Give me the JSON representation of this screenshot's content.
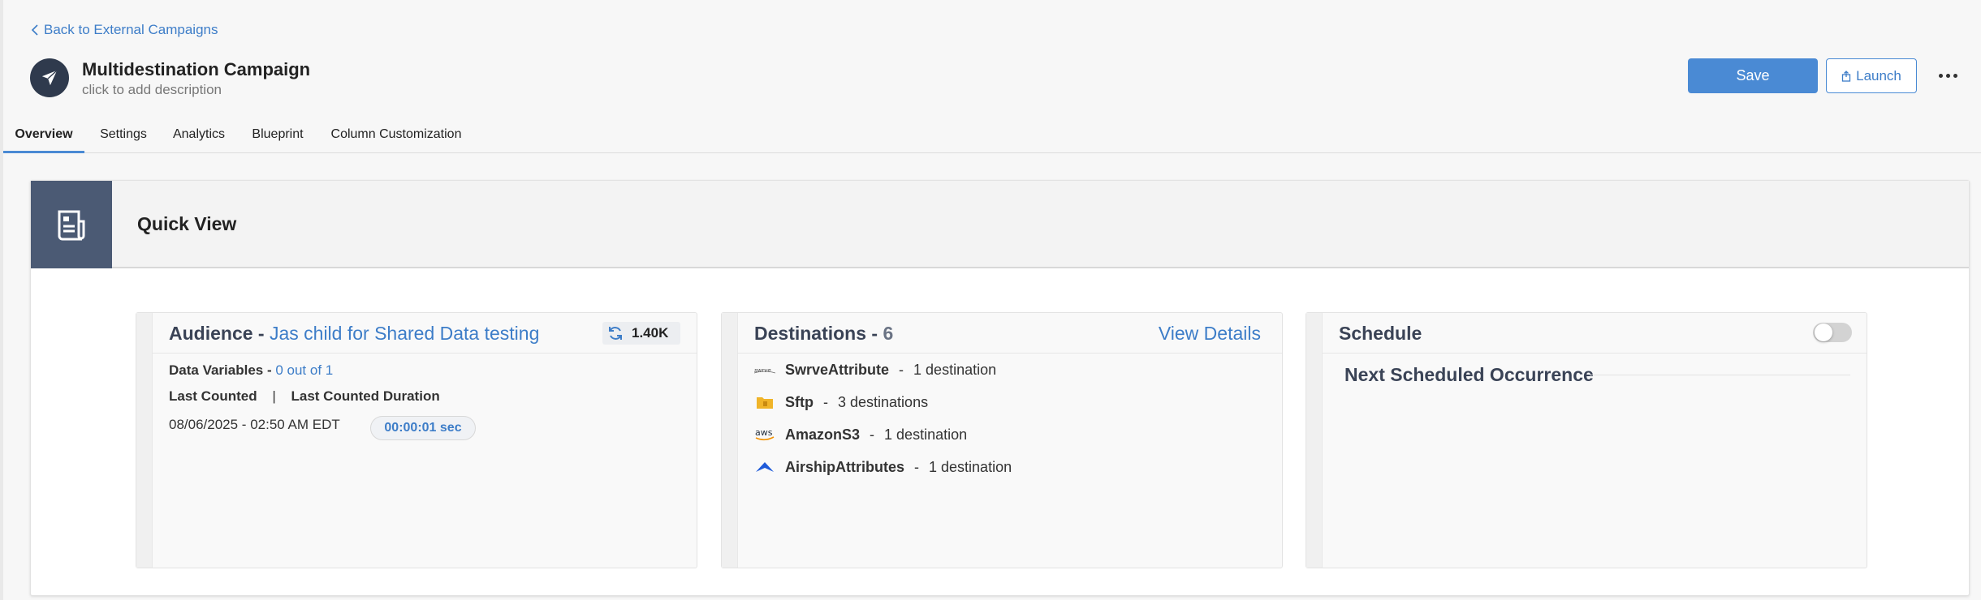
{
  "header": {
    "back_label": "Back to External Campaigns",
    "title": "Multidestination Campaign",
    "description_placeholder": "click to add description",
    "save_label": "Save",
    "launch_label": "Launch"
  },
  "tabs": [
    {
      "label": "Overview",
      "active": true
    },
    {
      "label": "Settings"
    },
    {
      "label": "Analytics"
    },
    {
      "label": "Blueprint"
    },
    {
      "label": "Column Customization"
    }
  ],
  "quick_view": {
    "title": "Quick View",
    "audience": {
      "prefix": "Audience - ",
      "name": "Jas child for Shared Data testing",
      "count": "1.40K",
      "data_variables_label": "Data Variables - ",
      "data_variables_value": "0 out of 1",
      "last_counted_label": "Last Counted",
      "divider": "|",
      "last_counted_duration_label": "Last Counted Duration",
      "last_counted_value": "08/06/2025 - 02:50 AM EDT",
      "duration_value": "00:00:01 sec"
    },
    "destinations": {
      "prefix": "Destinations - ",
      "count": "6",
      "view_details_label": "View Details",
      "items": [
        {
          "name": "SwrveAttribute",
          "sep": "-",
          "count": "1 destination",
          "icon": "swrve-icon"
        },
        {
          "name": "Sftp",
          "sep": "-",
          "count": "3 destinations",
          "icon": "folder-icon"
        },
        {
          "name": "AmazonS3",
          "sep": "-",
          "count": "1 destination",
          "icon": "aws-icon"
        },
        {
          "name": "AirshipAttributes",
          "sep": "-",
          "count": "1 destination",
          "icon": "airship-icon"
        }
      ]
    },
    "schedule": {
      "title": "Schedule",
      "enabled": false,
      "next_label": "Next Scheduled Occurrence"
    }
  },
  "colors": {
    "accent": "#4a8ad4",
    "link": "#3d7dc8",
    "panel_icon_bg": "#4b5a74",
    "campaign_icon_bg": "#2f3a4d"
  }
}
